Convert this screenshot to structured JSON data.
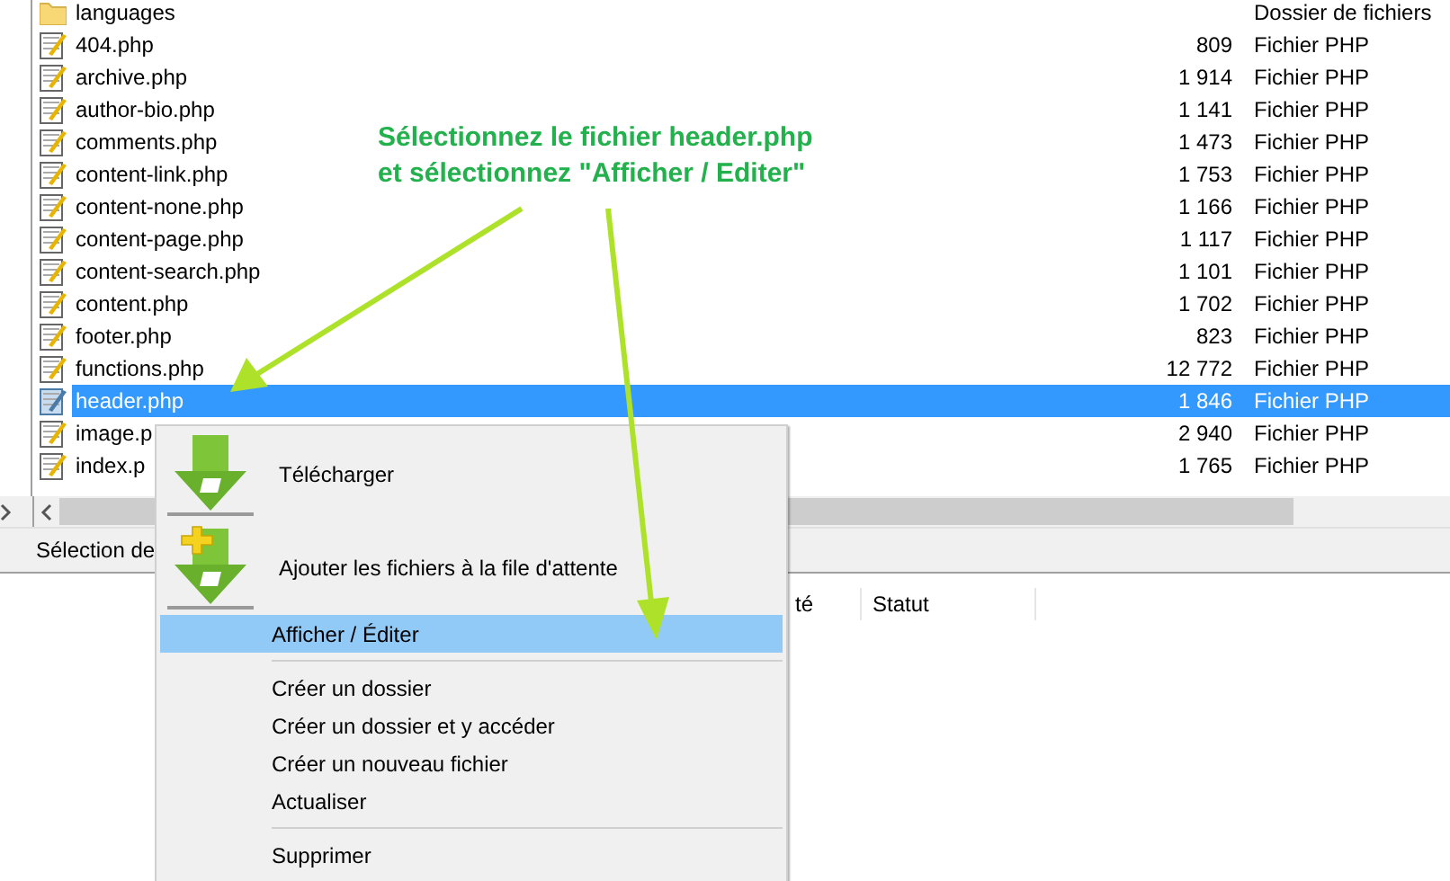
{
  "file_list": {
    "rows": [
      {
        "name": "languages",
        "size": "",
        "type": "Dossier de fichiers",
        "kind": "folder",
        "selected": false
      },
      {
        "name": "404.php",
        "size": "809",
        "type": "Fichier PHP",
        "kind": "php",
        "selected": false
      },
      {
        "name": "archive.php",
        "size": "1 914",
        "type": "Fichier PHP",
        "kind": "php",
        "selected": false
      },
      {
        "name": "author-bio.php",
        "size": "1 141",
        "type": "Fichier PHP",
        "kind": "php",
        "selected": false
      },
      {
        "name": "comments.php",
        "size": "1 473",
        "type": "Fichier PHP",
        "kind": "php",
        "selected": false
      },
      {
        "name": "content-link.php",
        "size": "1 753",
        "type": "Fichier PHP",
        "kind": "php",
        "selected": false
      },
      {
        "name": "content-none.php",
        "size": "1 166",
        "type": "Fichier PHP",
        "kind": "php",
        "selected": false
      },
      {
        "name": "content-page.php",
        "size": "1 117",
        "type": "Fichier PHP",
        "kind": "php",
        "selected": false
      },
      {
        "name": "content-search.php",
        "size": "1 101",
        "type": "Fichier PHP",
        "kind": "php",
        "selected": false
      },
      {
        "name": "content.php",
        "size": "1 702",
        "type": "Fichier PHP",
        "kind": "php",
        "selected": false
      },
      {
        "name": "footer.php",
        "size": "823",
        "type": "Fichier PHP",
        "kind": "php",
        "selected": false
      },
      {
        "name": "functions.php",
        "size": "12 772",
        "type": "Fichier PHP",
        "kind": "php",
        "selected": false
      },
      {
        "name": "header.php",
        "size": "1 846",
        "type": "Fichier PHP",
        "kind": "php",
        "selected": true
      },
      {
        "name": "image.p",
        "size": "2 940",
        "type": "Fichier PHP",
        "kind": "php",
        "selected": false
      },
      {
        "name": "index.p",
        "size": "1 765",
        "type": "Fichier PHP",
        "kind": "php",
        "selected": false
      }
    ]
  },
  "status_bar": {
    "text": "Sélection de"
  },
  "queue": {
    "columns": [
      "té",
      "Statut"
    ]
  },
  "context_menu": {
    "items": [
      {
        "kind": "download",
        "label": "Télécharger",
        "selected": false
      },
      {
        "kind": "queue",
        "label": "Ajouter les fichiers à la file d'attente",
        "selected": false
      },
      {
        "kind": "plain",
        "label": "Afficher / Éditer",
        "selected": true
      },
      {
        "kind": "separator"
      },
      {
        "kind": "plain",
        "label": "Créer un dossier",
        "selected": false
      },
      {
        "kind": "plain",
        "label": "Créer un dossier et y accéder",
        "selected": false
      },
      {
        "kind": "plain",
        "label": "Créer un nouveau fichier",
        "selected": false
      },
      {
        "kind": "plain",
        "label": "Actualiser",
        "selected": false
      },
      {
        "kind": "separator"
      },
      {
        "kind": "plain",
        "label": "Supprimer",
        "selected": false
      }
    ]
  },
  "annotation": {
    "lines": [
      "Sélectionnez le fichier header.php",
      "et sélectionnez \"Afficher / Editer\""
    ]
  }
}
